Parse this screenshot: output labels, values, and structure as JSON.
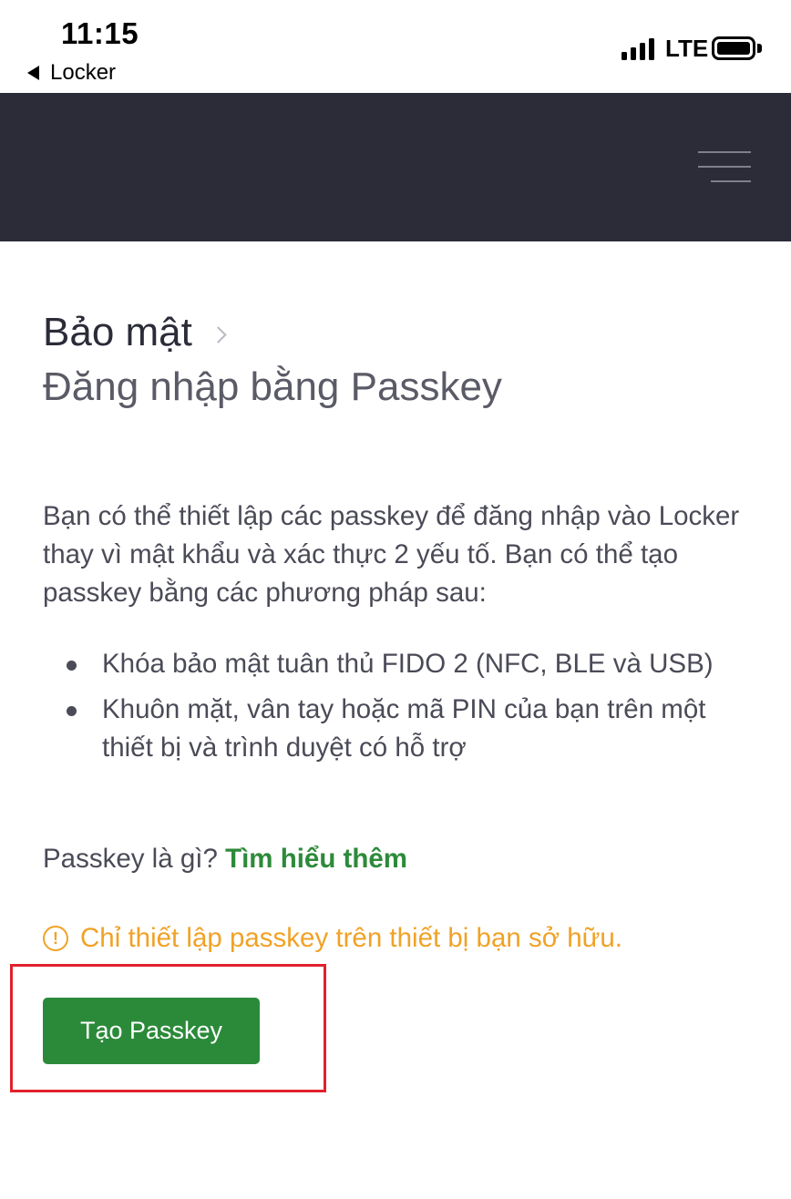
{
  "status_bar": {
    "time": "11:15",
    "back_app": "Locker",
    "network": "LTE"
  },
  "header": {
    "menu_icon": "hamburger-icon",
    "background": "#2b2c38"
  },
  "breadcrumb": {
    "parent": "Bảo mật",
    "current": "Đăng nhập bằng Passkey"
  },
  "content": {
    "intro": "Bạn có thể thiết lập các passkey để đăng nhập vào Locker thay vì mật khẩu và xác thực 2 yếu tố. Bạn có thể tạo passkey bằng các phương pháp sau:",
    "methods": [
      "Khóa bảo mật tuân thủ FIDO 2 (NFC, BLE và USB)",
      "Khuôn mặt, vân tay hoặc mã PIN của bạn trên một thiết bị và trình duyệt có hỗ trợ"
    ],
    "whatis_prefix": "Passkey là gì?",
    "learn_more": "Tìm hiểu thêm",
    "warning": "Chỉ thiết lập passkey trên thiết bị bạn sở hữu.",
    "create_button": "Tạo Passkey"
  },
  "colors": {
    "accent_green": "#2b8a39",
    "warning_orange": "#f0a226",
    "highlight_red": "#e0222c"
  }
}
